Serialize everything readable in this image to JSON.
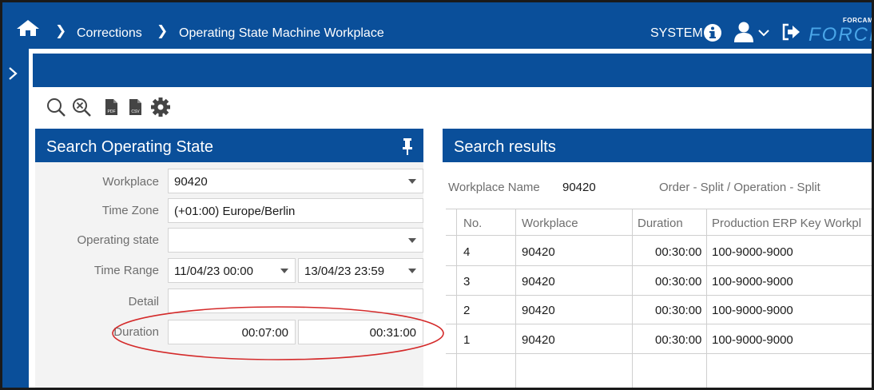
{
  "header": {
    "breadcrumb": [
      "Corrections",
      "Operating State Machine Workplace"
    ],
    "user_label": "SYSTEM",
    "logo_top": "FORCAM",
    "logo_main": "FORCE"
  },
  "toolbar": {
    "icons": [
      "search-icon",
      "clear-search-icon",
      "pdf-export-icon",
      "csv-export-icon",
      "settings-icon"
    ],
    "pdf_label": "PDF",
    "csv_label": "CSV"
  },
  "search_panel": {
    "title": "Search Operating State",
    "fields": {
      "workplace": {
        "label": "Workplace",
        "value": "90420"
      },
      "time_zone": {
        "label": "Time Zone",
        "value": "(+01:00) Europe/Berlin"
      },
      "operating_state": {
        "label": "Operating state",
        "value": ""
      },
      "time_range": {
        "label": "Time Range",
        "from": "11/04/23 00:00",
        "to": "13/04/23 23:59"
      },
      "detail": {
        "label": "Detail",
        "value": ""
      },
      "duration": {
        "label": "Duration",
        "from": "00:07:00",
        "to": "00:31:00"
      }
    }
  },
  "results_panel": {
    "title": "Search results",
    "workplace_name_label": "Workplace Name",
    "workplace_name_value": "90420",
    "order_split_label": "Order - Split / Operation - Split",
    "columns": [
      "No.",
      "Workplace",
      "Duration",
      "Production ERP Key Workpl"
    ],
    "rows": [
      [
        "4",
        "90420",
        "00:30:00",
        "100-9000-9000"
      ],
      [
        "3",
        "90420",
        "00:30:00",
        "100-9000-9000"
      ],
      [
        "2",
        "90420",
        "00:30:00",
        "100-9000-9000"
      ],
      [
        "1",
        "90420",
        "00:30:00",
        "100-9000-9000"
      ]
    ]
  },
  "colors": {
    "brand_blue": "#0a4f9a",
    "highlight_ellipse": "#d42a2a"
  }
}
